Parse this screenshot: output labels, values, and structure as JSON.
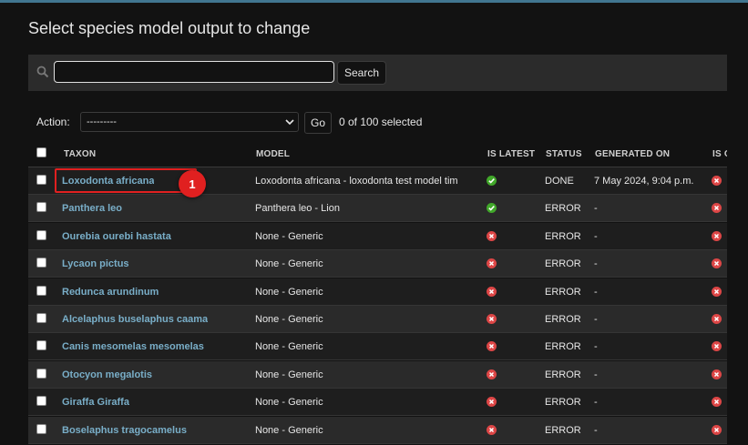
{
  "page": {
    "title": "Select species model output to change"
  },
  "search": {
    "value": "",
    "button_label": "Search"
  },
  "actions": {
    "label": "Action:",
    "selected_option": "---------",
    "go_label": "Go",
    "selected_text": "0 of 100 selected"
  },
  "table": {
    "columns": [
      "TAXON",
      "MODEL",
      "IS LATEST",
      "STATUS",
      "GENERATED ON",
      "IS O"
    ],
    "rows": [
      {
        "taxon": "Loxodonta africana",
        "model": "Loxodonta africana - loxodonta test model tim",
        "is_latest": true,
        "status": "DONE",
        "generated_on": "7 May 2024, 9:04 p.m.",
        "is_o": false
      },
      {
        "taxon": "Panthera leo",
        "model": "Panthera leo - Lion",
        "is_latest": true,
        "status": "ERROR",
        "generated_on": "-",
        "is_o": false
      },
      {
        "taxon": "Ourebia ourebi hastata",
        "model": "None - Generic",
        "is_latest": false,
        "status": "ERROR",
        "generated_on": "-",
        "is_o": false
      },
      {
        "taxon": "Lycaon pictus",
        "model": "None - Generic",
        "is_latest": false,
        "status": "ERROR",
        "generated_on": "-",
        "is_o": false
      },
      {
        "taxon": "Redunca arundinum",
        "model": "None - Generic",
        "is_latest": false,
        "status": "ERROR",
        "generated_on": "-",
        "is_o": false
      },
      {
        "taxon": "Alcelaphus buselaphus caama",
        "model": "None - Generic",
        "is_latest": false,
        "status": "ERROR",
        "generated_on": "-",
        "is_o": false
      },
      {
        "taxon": "Canis mesomelas mesomelas",
        "model": "None - Generic",
        "is_latest": false,
        "status": "ERROR",
        "generated_on": "-",
        "is_o": false
      },
      {
        "taxon": "Otocyon megalotis",
        "model": "None - Generic",
        "is_latest": false,
        "status": "ERROR",
        "generated_on": "-",
        "is_o": false
      },
      {
        "taxon": "Giraffa Giraffa",
        "model": "None - Generic",
        "is_latest": false,
        "status": "ERROR",
        "generated_on": "-",
        "is_o": false
      },
      {
        "taxon": "Boselaphus tragocamelus",
        "model": "None - Generic",
        "is_latest": false,
        "status": "ERROR",
        "generated_on": "-",
        "is_o": false
      }
    ]
  },
  "annotation": {
    "marker_label": "1"
  },
  "colors": {
    "link": "#79aec8",
    "yes": "#41a82a",
    "no": "#dd4646",
    "highlight": "#e02020",
    "accent": "#417690"
  }
}
